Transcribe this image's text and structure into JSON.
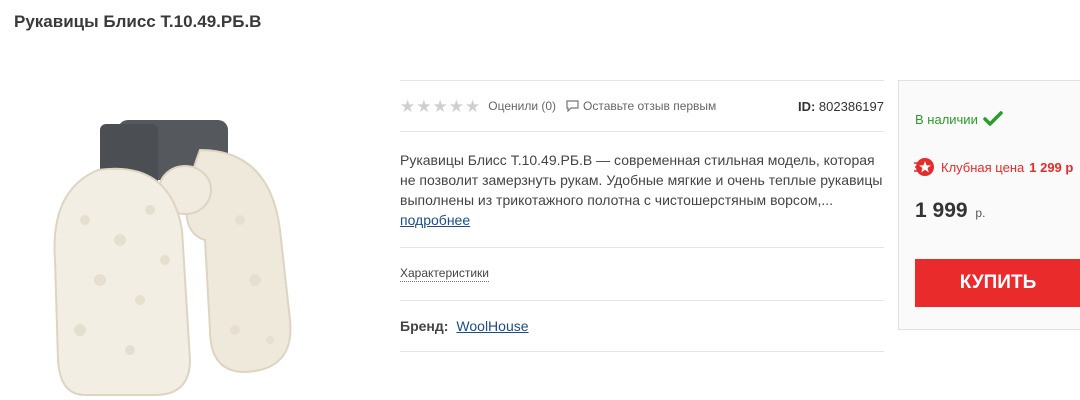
{
  "product": {
    "title": "Рукавицы Блисс Т.10.49.РБ.В",
    "image_icon": "mittens-photo",
    "rating": {
      "stars_filled": 0,
      "stars_total": 5,
      "rated_label": "Оценили (0)",
      "review_label": "Оставьте отзыв первым",
      "review_icon": "comment-icon"
    },
    "id_label": "ID:",
    "id_value": "802386197",
    "description": "Рукавицы Блисс Т.10.49.РБ.В — современная стильная модель, которая не позволит замерзнуть рукам. Удобные мягкие и очень теплые рукавицы выполнены из трикотажного полотна с чистошерстяным ворсом,...",
    "more_link": "подробнее",
    "characteristics_label": "Характеристики",
    "brand_label": "Бренд:",
    "brand_value": "WoolHouse"
  },
  "buybox": {
    "stock_label": "В наличии",
    "club_label": "Клубная цена",
    "club_price": "1 299 р",
    "price_value": "1 999",
    "price_currency": "р.",
    "buy_label": "КУПИТЬ",
    "colors": {
      "accent": "#ea2b2b",
      "stock": "#2a9d2a",
      "link": "#1a4e8a"
    }
  }
}
